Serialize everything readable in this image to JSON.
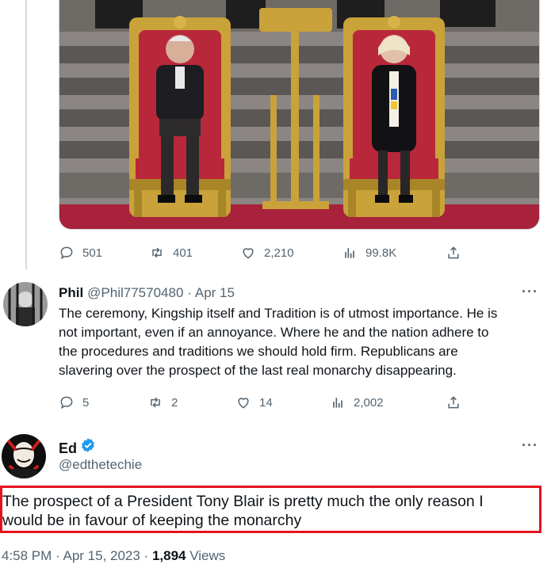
{
  "top_tweet": {
    "stats": {
      "replies": "501",
      "retweets": "401",
      "likes": "2,210",
      "views": "99.8K"
    }
  },
  "reply": {
    "name": "Phil",
    "handle": "@Phil77570480",
    "date": "· Apr 15",
    "more": "···",
    "lines": [
      "The ceremony, Kingship itself and Tradition is of utmost importance. He is",
      "not important, even if an annoyance. Where he and the nation adhere to",
      "the procedures and traditions we should hold firm. Republicans are",
      "slavering over the prospect of the last real monarchy disappearing."
    ],
    "stats": {
      "replies": "5",
      "retweets": "2",
      "likes": "14",
      "views": "2,002"
    }
  },
  "main_tweet": {
    "name": "Ed",
    "handle": "@edthetechie",
    "more": "···",
    "lines": [
      "The prospect of a President Tony Blair is pretty much the only reason I",
      "would be in favour of keeping the monarchy"
    ],
    "timestamp": "4:58 PM · Apr 15, 2023 · ",
    "views_count": "1,894",
    "views_label": " Views"
  },
  "colors": {
    "highlight_border": "#e3141e",
    "verified": "#1d9bf0",
    "muted": "#536471",
    "throne_red": "#b8283a",
    "gold": "#c9a23a"
  },
  "icons": [
    "reply-icon",
    "retweet-icon",
    "like-icon",
    "views-icon",
    "share-icon",
    "verified-badge-icon",
    "more-icon"
  ]
}
